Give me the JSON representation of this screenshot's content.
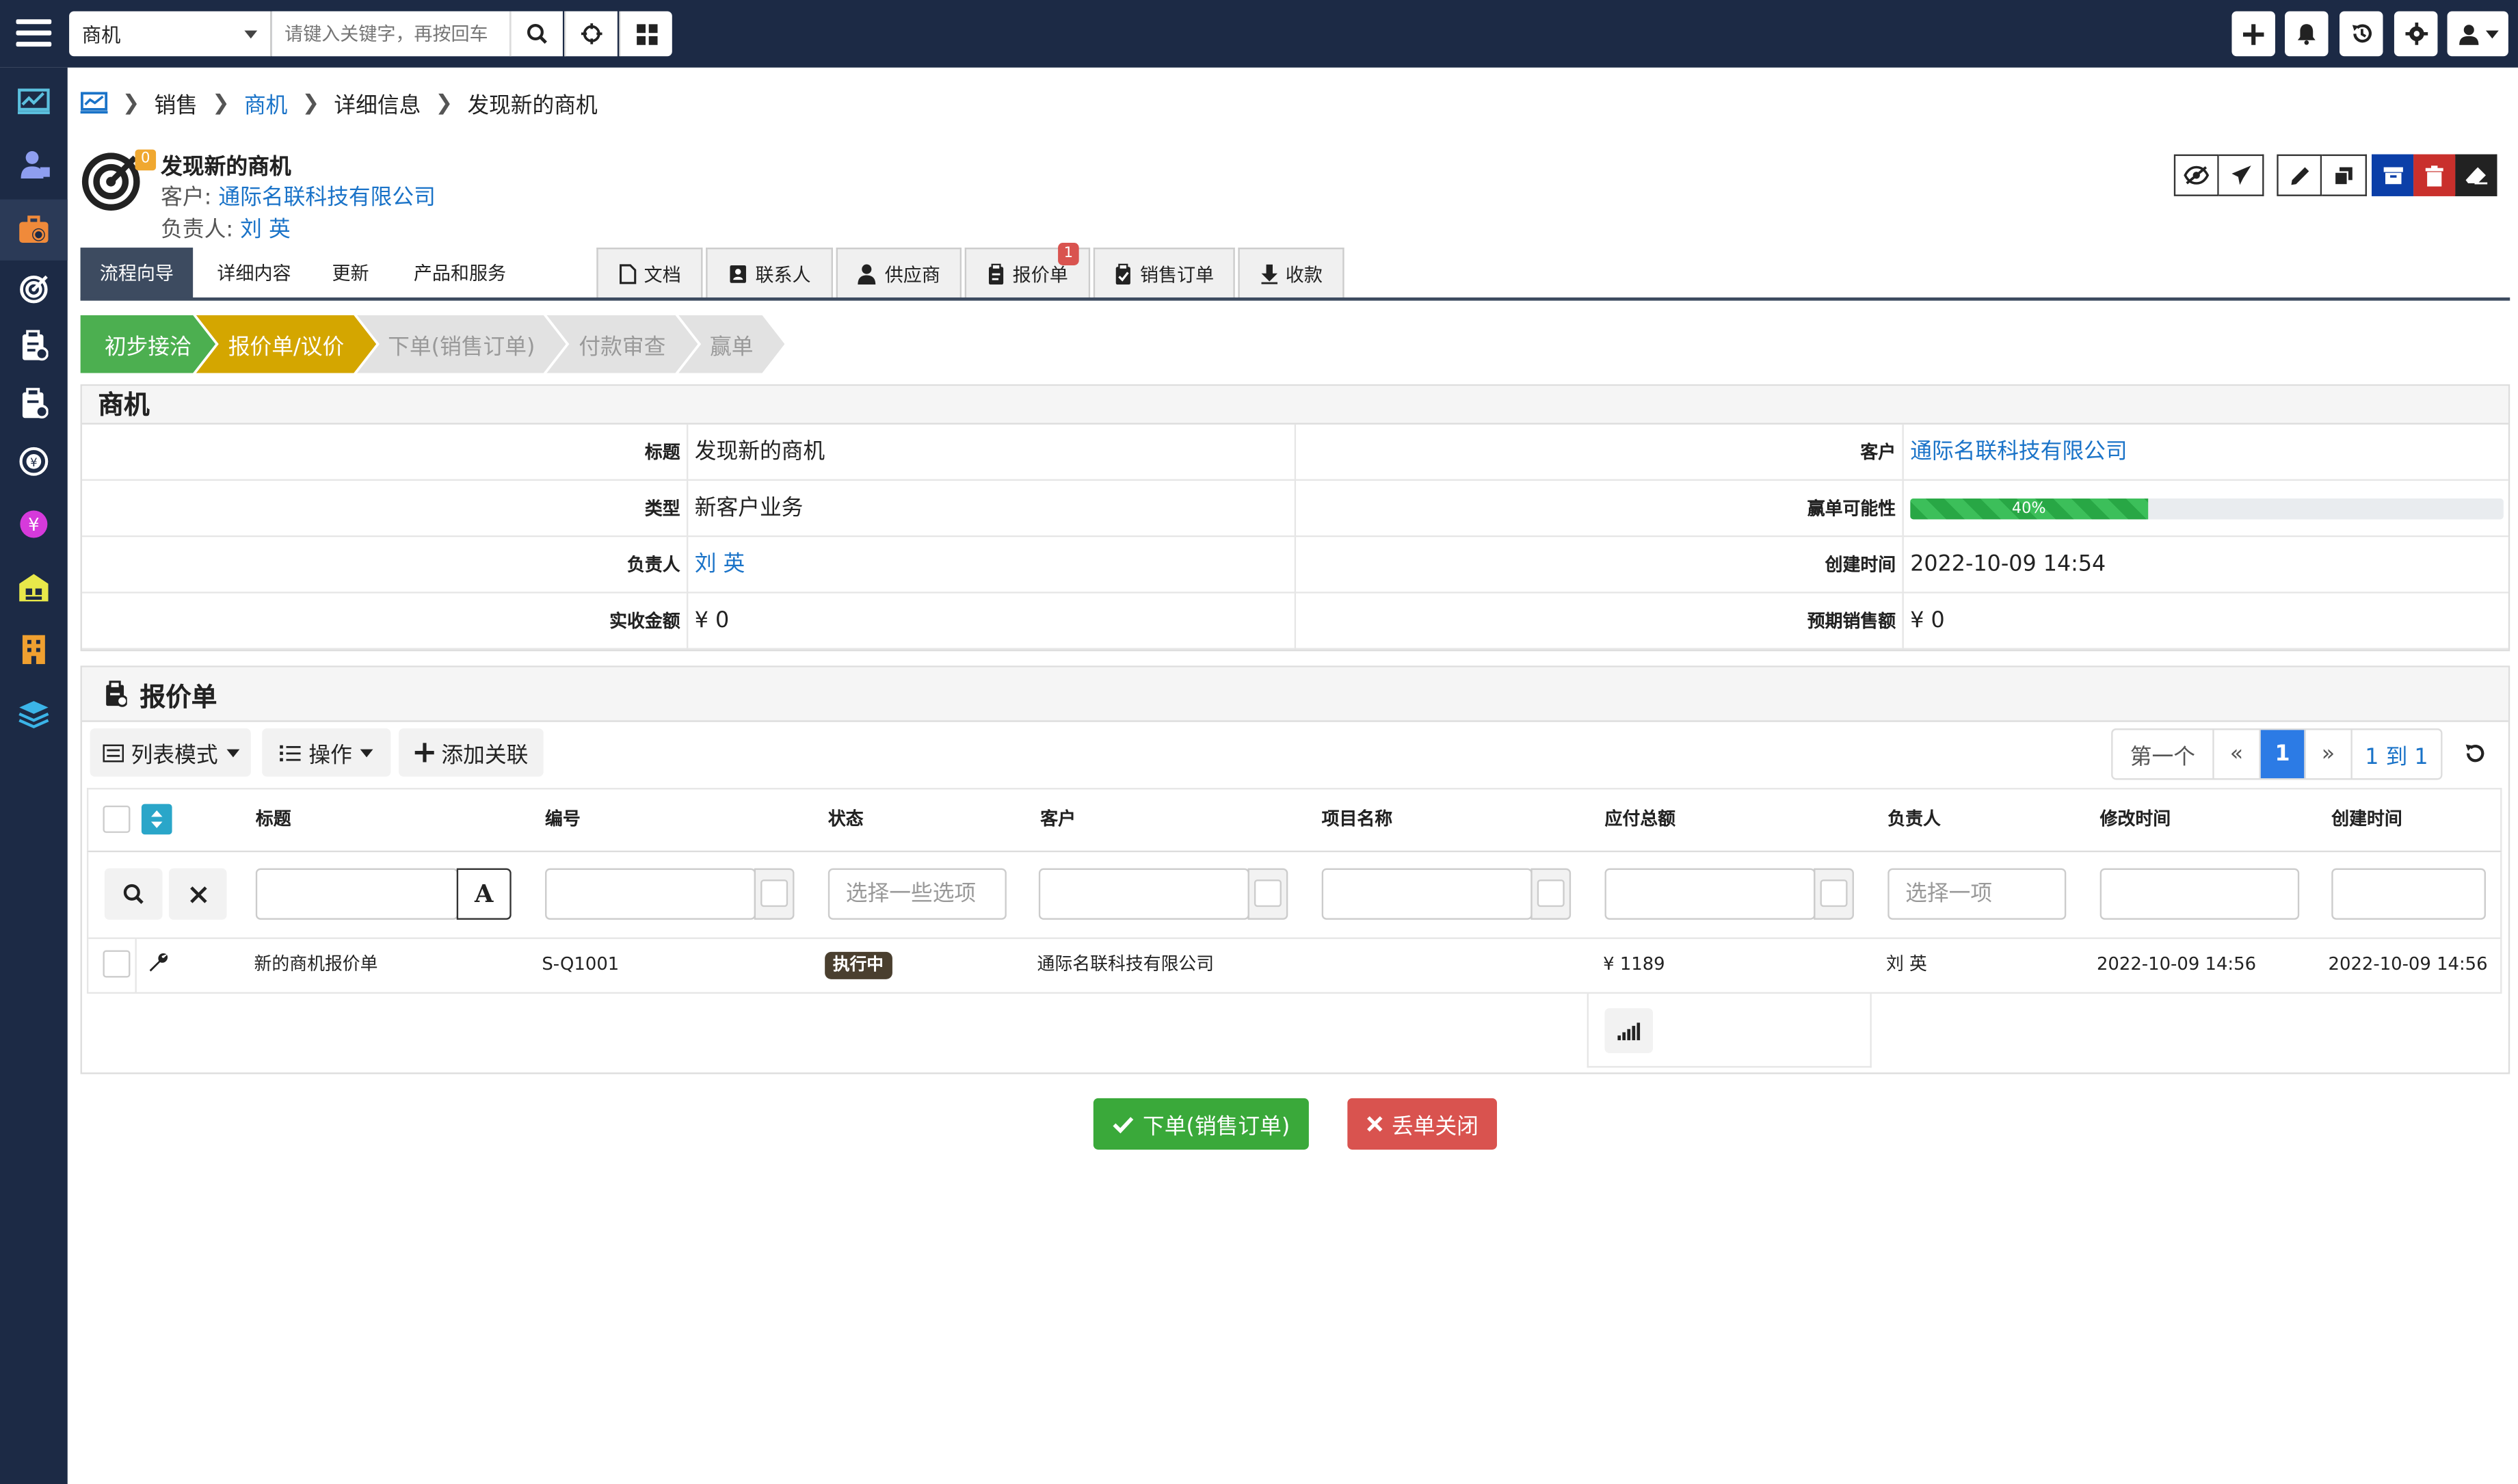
{
  "topbar": {
    "module": "商机",
    "search_placeholder": "请键入关键字，再按回车",
    "colors": {
      "bg": "#1c2a45"
    }
  },
  "breadcrumb": {
    "items": [
      "销售",
      "商机",
      "详细信息",
      "发现新的商机"
    ]
  },
  "record": {
    "title": "发现新的商机",
    "badge": "0",
    "customer_label": "客户:",
    "customer": "通际名联科技有限公司",
    "owner_label": "负责人:",
    "owner": "刘 英"
  },
  "tabs": [
    {
      "label": "流程向导"
    },
    {
      "label": "详细内容"
    },
    {
      "label": "更新"
    },
    {
      "label": "产品和服务"
    },
    {
      "label": "文档"
    },
    {
      "label": "联系人"
    },
    {
      "label": "供应商"
    },
    {
      "label": "报价单",
      "badge": "1"
    },
    {
      "label": "销售订单"
    },
    {
      "label": "收款"
    }
  ],
  "steps": [
    {
      "label": "初步接洽",
      "state": "done"
    },
    {
      "label": "报价单/议价",
      "state": "current"
    },
    {
      "label": "下单(销售订单)",
      "state": "todo"
    },
    {
      "label": "付款审查",
      "state": "todo"
    },
    {
      "label": "赢单",
      "state": "todo"
    }
  ],
  "opportunity": {
    "heading": "商机",
    "fields": {
      "title_label": "标题",
      "title_value": "发现新的商机",
      "customer_label": "客户",
      "customer_value": "通际名联科技有限公司",
      "type_label": "类型",
      "type_value": "新客户业务",
      "probability_label": "赢单可能性",
      "probability_value": "40%",
      "owner_label": "负责人",
      "owner_value": "刘 英",
      "created_label": "创建时间",
      "created_value": "2022-10-09 14:54",
      "received_label": "实收金额",
      "received_value": "¥ 0",
      "expected_label": "预期销售额",
      "expected_value": "¥ 0"
    },
    "probability": 0.4
  },
  "quotes": {
    "heading": "报价单",
    "toolbar": {
      "list_mode": "列表模式",
      "actions": "操作",
      "add_relation": "添加关联"
    },
    "pager": {
      "first": "第一个",
      "prev": "«",
      "current": "1",
      "next": "»",
      "range": "1 到 1"
    },
    "columns": [
      "标题",
      "编号",
      "状态",
      "客户",
      "项目名称",
      "应付总额",
      "负责人",
      "修改时间",
      "创建时间"
    ],
    "filters": {
      "status_placeholder": "选择一些选项",
      "owner_placeholder": "选择一项",
      "title_format_btn": "A"
    },
    "rows": [
      {
        "title": "新的商机报价单",
        "code": "S-Q1001",
        "status": "执行中",
        "customer": "通际名联科技有限公司",
        "project": "",
        "total": "¥ 1189",
        "owner": "刘 英",
        "modified": "2022-10-09 14:56",
        "created": "2022-10-09 14:56"
      }
    ]
  },
  "actions": {
    "order": "下单(销售订单)",
    "close": "丢单关闭"
  },
  "colors": {
    "primary_link": "#1a73c8",
    "step_done": "#4caf50",
    "step_current": "#d4a600",
    "step_todo": "#e2e2e2",
    "success": "#3aa93a",
    "danger": "#d9534f",
    "tab_active": "#3d4b60"
  }
}
